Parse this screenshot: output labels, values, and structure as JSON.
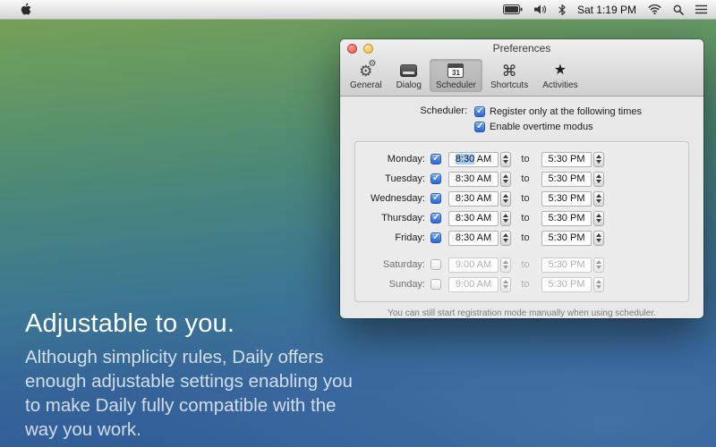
{
  "menu_bar": {
    "time": "Sat 1:19 PM",
    "icons": [
      "apple",
      "battery",
      "volume",
      "bluetooth",
      "wifi",
      "spotlight",
      "notification-center"
    ]
  },
  "window": {
    "title": "Preferences",
    "toolbar": [
      {
        "label": "General"
      },
      {
        "label": "Dialog"
      },
      {
        "label": "Scheduler",
        "selected": true,
        "icon_text": "31"
      },
      {
        "label": "Shortcuts"
      },
      {
        "label": "Activities"
      }
    ],
    "scheduler_label": "Scheduler:",
    "checkboxes": [
      {
        "label": "Register only at the following times",
        "checked": true
      },
      {
        "label": "Enable overtime modus",
        "checked": true
      }
    ],
    "to_label": "to",
    "days": [
      {
        "label": "Monday:",
        "checked": true,
        "start": "8:30 AM",
        "end": "5:30 PM",
        "start_selected": "8:30",
        "start_suffix": " AM"
      },
      {
        "label": "Tuesday:",
        "checked": true,
        "start": "8:30 AM",
        "end": "5:30 PM"
      },
      {
        "label": "Wednesday:",
        "checked": true,
        "start": "8:30 AM",
        "end": "5:30 PM"
      },
      {
        "label": "Thursday:",
        "checked": true,
        "start": "8:30 AM",
        "end": "5:30 PM"
      },
      {
        "label": "Friday:",
        "checked": true,
        "start": "8:30 AM",
        "end": "5:30 PM"
      },
      {
        "label": "Saturday:",
        "checked": false,
        "start": "9:00 AM",
        "end": "5:30 PM"
      },
      {
        "label": "Sunday:",
        "checked": false,
        "start": "9:00 AM",
        "end": "5:30 PM"
      }
    ],
    "footer_note": "You can still start registration mode manually when using scheduler."
  },
  "hero": {
    "title": "Adjustable to you.",
    "body": "Although simplicity rules, Daily offers enough adjustable settings enabling you to make Daily fully compatible with the way you work."
  },
  "colors": {
    "checkbox_blue": "#2b66d8",
    "text_selection_blue": "#a8cbf7",
    "background_top_green": "#7aa255",
    "background_bottom_blue": "#2f5a94"
  }
}
